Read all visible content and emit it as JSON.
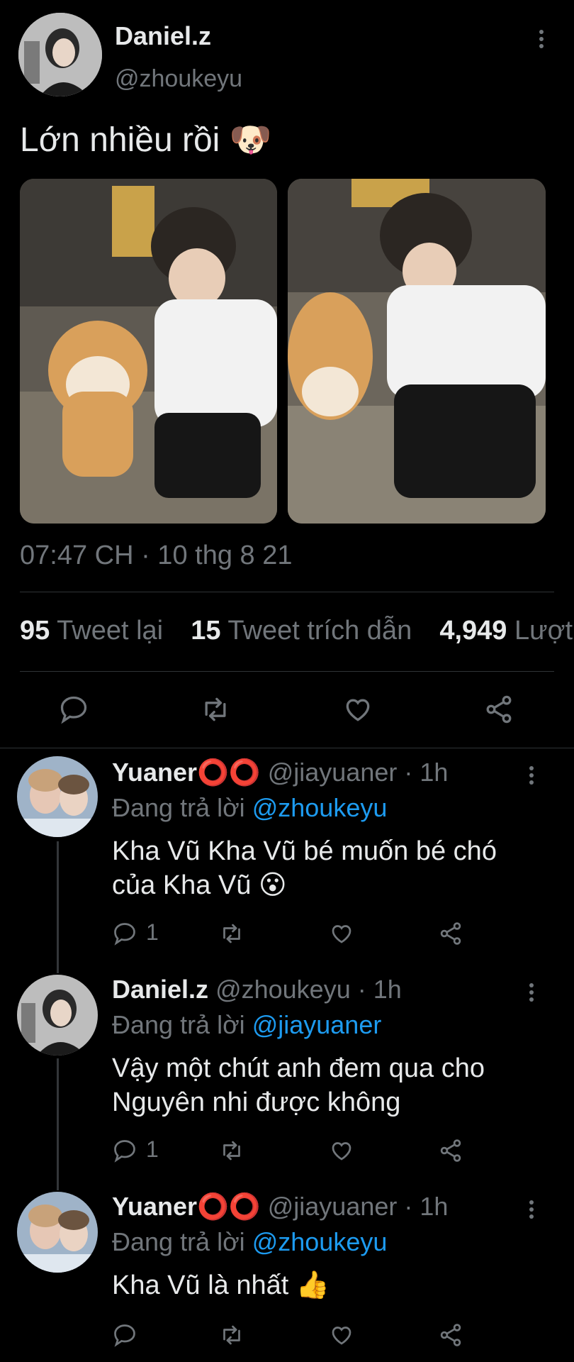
{
  "tweet": {
    "author_name": "Daniel.z",
    "author_handle": "@zhoukeyu",
    "text": "Lớn nhiều rồi 🐶",
    "timestamp": "07:47 CH · 10 thg 8 21",
    "stats": {
      "retweets_count": "95",
      "retweets_label": "Tweet lại",
      "quotes_count": "15",
      "quotes_label": "Tweet trích dẫn",
      "likes_count": "4,949",
      "likes_label": "Lượt thích"
    },
    "actions": [
      "reply-icon",
      "retweet-icon",
      "like-icon",
      "share-icon"
    ]
  },
  "replies": [
    {
      "name": "Yuaner⭕⭕",
      "handle": "@jiayuaner · 1h",
      "replying_prefix": "Đang trả lời",
      "replying_to": "@zhoukeyu",
      "text_line1": "Kha Vũ Kha Vũ bé muốn bé chó",
      "text_line2": "của Kha Vũ 😮",
      "reply_count": "1"
    },
    {
      "name": "Daniel.z",
      "handle": "@zhoukeyu · 1h",
      "replying_prefix": "Đang trả lời",
      "replying_to": "@jiayuaner",
      "text_line1": "Vậy một chút anh đem qua cho",
      "text_line2": "Nguyên nhi được không",
      "reply_count": "1"
    },
    {
      "name": "Yuaner⭕⭕",
      "handle": "@jiayuaner · 1h",
      "replying_prefix": "Đang trả lời",
      "replying_to": "@zhoukeyu",
      "text_line1": "Kha Vũ là nhất 👍",
      "text_line2": "",
      "reply_count": ""
    }
  ],
  "colors": {
    "background": "#000000",
    "accent": "#1d9bf0",
    "muted": "#71767b",
    "divider": "#2f3336"
  }
}
